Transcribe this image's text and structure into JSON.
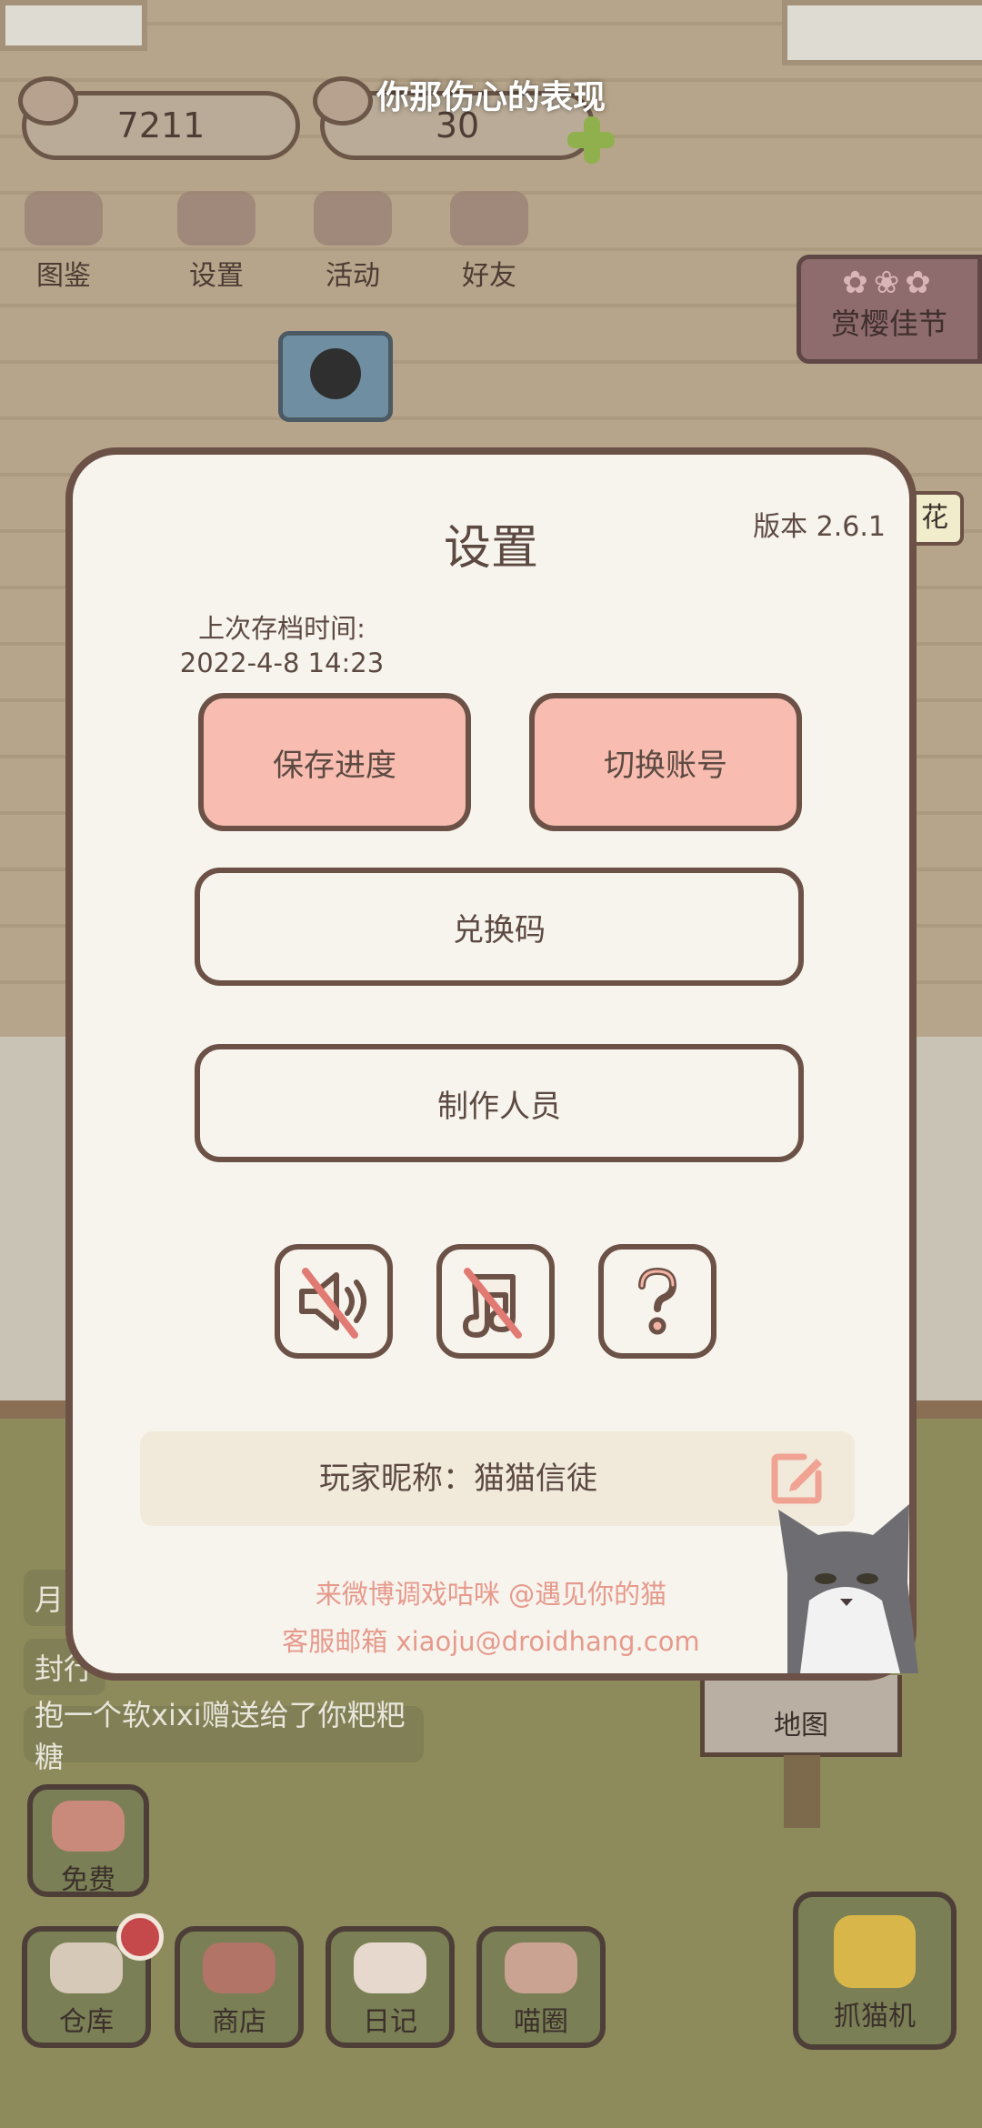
{
  "overlay_caption": "你那伤心的表现",
  "hud": {
    "fish_count": "7211",
    "can_count": "30"
  },
  "top_menu": [
    {
      "label": "图鉴",
      "icon": "cat-face-icon"
    },
    {
      "label": "设置",
      "icon": "gear-icon"
    },
    {
      "label": "活动",
      "icon": "gift-icon"
    },
    {
      "label": "好友",
      "icon": "friends-icon"
    }
  ],
  "event_sign": {
    "label": "赏樱佳节",
    "partial_label": "花"
  },
  "settings": {
    "title": "设置",
    "version": "版本 2.6.1",
    "last_save_label": "上次存档时间:",
    "last_save_time": "2022-4-8 14:23",
    "save_button": "保存进度",
    "switch_account_button": "切换账号",
    "redeem_button": "兑换码",
    "credits_button": "制作人员",
    "sound_toggle": "sound-muted-icon",
    "music_toggle": "music-muted-icon",
    "help_button": "question-icon",
    "nickname": "玩家昵称：猫猫信徒",
    "weibo_line": "来微博调戏咕咪 @遇见你的猫",
    "email_line": "客服邮箱 xiaoju@droidhang.com"
  },
  "chat": {
    "partial_line_1": "月",
    "partial_line_2": "封行",
    "gift_message": "抱一个软xixi赠送给了你粑粑糖"
  },
  "bottom_menu": {
    "free": "免费",
    "warehouse": "仓库",
    "shop": "商店",
    "diary": "日记",
    "cat_circle": "喵圈",
    "claw_machine": "抓猫机",
    "map": "地图"
  },
  "colors": {
    "modal_bg": "#f7f4ee",
    "modal_border": "#6c5146",
    "pink_button": "#f8bdb0",
    "footer_text": "#e69a8c",
    "mute_slash": "#e07a73"
  }
}
